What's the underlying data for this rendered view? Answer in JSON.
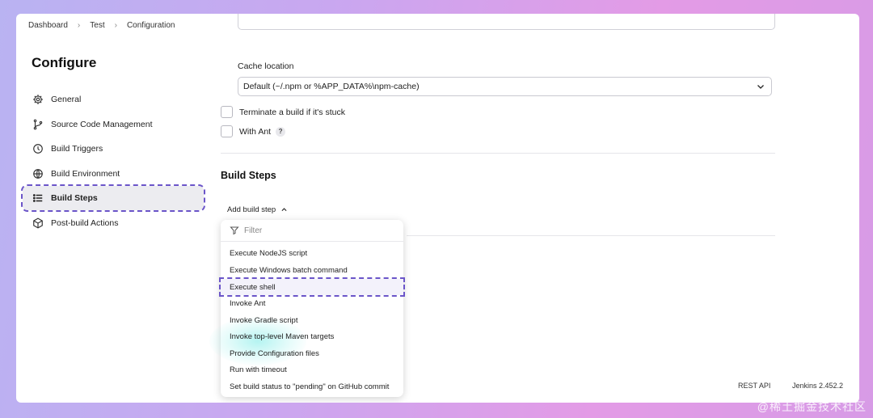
{
  "breadcrumb": [
    "Dashboard",
    "Test",
    "Configuration"
  ],
  "sidebar": {
    "title": "Configure",
    "items": [
      {
        "label": "General",
        "icon": "gear-icon"
      },
      {
        "label": "Source Code Management",
        "icon": "branch-icon"
      },
      {
        "label": "Build Triggers",
        "icon": "clock-icon"
      },
      {
        "label": "Build Environment",
        "icon": "globe-icon"
      },
      {
        "label": "Build Steps",
        "icon": "list-icon",
        "active": true
      },
      {
        "label": "Post-build Actions",
        "icon": "package-icon"
      }
    ]
  },
  "main": {
    "cache_label": "Cache location",
    "cache_value": "Default (~/.npm or %APP_DATA%\\npm-cache)",
    "terminate_label": "Terminate a build if it's stuck",
    "ant_label": "With Ant",
    "help_glyph": "?",
    "build_steps_title": "Build Steps",
    "add_step_label": "Add build step"
  },
  "dropdown": {
    "filter_placeholder": "Filter",
    "items": [
      "Execute NodeJS script",
      "Execute Windows batch command",
      "Execute shell",
      "Invoke Ant",
      "Invoke Gradle script",
      "Invoke top-level Maven targets",
      "Provide Configuration files",
      "Run with timeout",
      "Set build status to \"pending\" on GitHub commit"
    ],
    "highlighted_index": 2
  },
  "footer": {
    "rest_api": "REST API",
    "version": "Jenkins 2.452.2"
  },
  "watermark": "@稀土掘金技术社区",
  "colors": {
    "accent": "#6b55c9",
    "active_bg": "#ececf0"
  }
}
